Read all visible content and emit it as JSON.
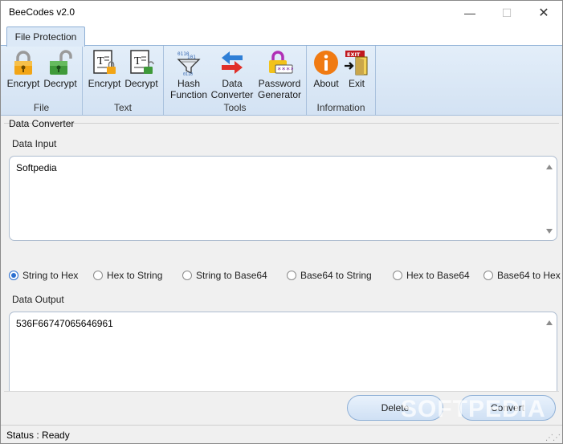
{
  "window": {
    "title": "BeeCodes v2.0"
  },
  "tabs": [
    {
      "label": "File Protection"
    }
  ],
  "ribbon": {
    "groups": [
      {
        "label": "File",
        "buttons": [
          {
            "label": "Encrypt",
            "icon": "lock-closed-icon"
          },
          {
            "label": "Decrypt",
            "icon": "lock-open-icon"
          }
        ]
      },
      {
        "label": "Text",
        "buttons": [
          {
            "label": "Encrypt",
            "icon": "text-lock-icon"
          },
          {
            "label": "Decrypt",
            "icon": "text-unlock-icon"
          }
        ]
      },
      {
        "label": "Tools",
        "buttons": [
          {
            "label_line1": "Hash",
            "label_line2": "Function",
            "icon": "funnel-icon"
          },
          {
            "label_line1": "Data",
            "label_line2": "Converter",
            "icon": "swap-arrows-icon"
          },
          {
            "label_line1": "Password",
            "label_line2": "Generator",
            "icon": "password-lock-icon"
          }
        ]
      },
      {
        "label": "Information",
        "buttons": [
          {
            "label": "About",
            "icon": "info-icon"
          },
          {
            "label": "Exit",
            "icon": "exit-door-icon"
          }
        ]
      }
    ]
  },
  "panel": {
    "title": "Data Converter",
    "input_label": "Data Input",
    "input_value": "Softpedia",
    "output_label": "Data Output",
    "output_value": "536F66747065646961",
    "modes": [
      {
        "label": "String to Hex",
        "selected": true
      },
      {
        "label": "Hex to String",
        "selected": false
      },
      {
        "label": "String to Base64",
        "selected": false
      },
      {
        "label": "Base64 to String",
        "selected": false
      },
      {
        "label": "Hex to Base64",
        "selected": false
      },
      {
        "label": "Base64 to Hex",
        "selected": false
      }
    ]
  },
  "actions": {
    "delete_label": "Delete",
    "convert_label": "Convert"
  },
  "status": {
    "text": "Status : Ready"
  },
  "watermark": "SOFTPEDIA",
  "colors": {
    "accent": "#2b6fd0",
    "ribbon": "#d3e2f3",
    "exit_red": "#c0181f",
    "about_orange": "#f07a12"
  }
}
